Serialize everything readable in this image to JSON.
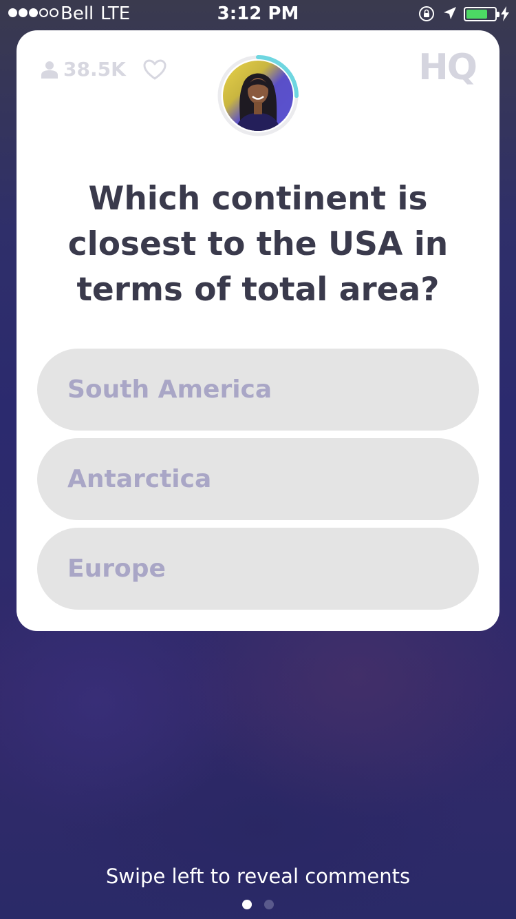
{
  "status_bar": {
    "carrier": "Bell",
    "network": "LTE",
    "time": "3:12 PM",
    "signal_bars_filled": 3,
    "signal_bars_total": 5,
    "battery_level": 0.75,
    "battery_color": "#4cd964"
  },
  "header": {
    "viewer_count": "38.5K",
    "viewer_icon": "user-icon",
    "like_icon": "heart-icon",
    "logo_text": "HQ",
    "timer_progress": 0.25,
    "timer_color": "#6ed6e0"
  },
  "question": {
    "text": "Which continent is closest to the USA in terms of total area?"
  },
  "answers": [
    {
      "label": "South America"
    },
    {
      "label": "Antarctica"
    },
    {
      "label": "Europe"
    }
  ],
  "footer": {
    "hint": "Swipe left to reveal comments",
    "page_count": 2,
    "active_page": 1
  }
}
